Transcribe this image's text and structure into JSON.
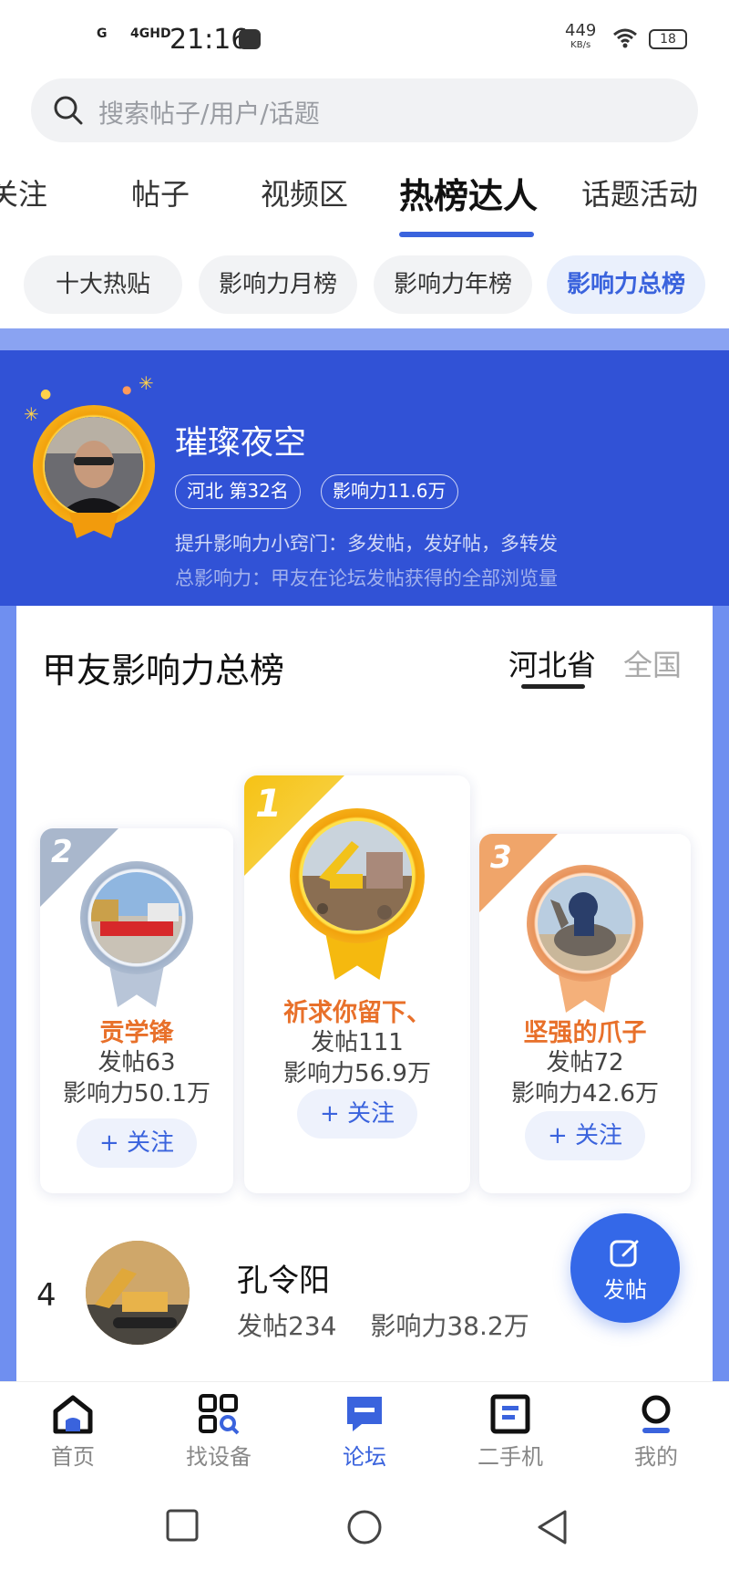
{
  "status_bar": {
    "signal1": "G",
    "signal2": "4GHD",
    "time": "21:16",
    "speed": "449",
    "speed_unit": "KB/s",
    "battery": "18"
  },
  "search": {
    "placeholder": "搜索帖子/用户/话题"
  },
  "tabs": [
    {
      "label": "关注"
    },
    {
      "label": "帖子"
    },
    {
      "label": "视频区"
    },
    {
      "label": "热榜达人"
    },
    {
      "label": "话题活动"
    }
  ],
  "sub_tabs": [
    {
      "label": "十大热贴"
    },
    {
      "label": "影响力月榜"
    },
    {
      "label": "影响力年榜"
    },
    {
      "label": "影响力总榜"
    }
  ],
  "hero": {
    "name": "璀璨夜空",
    "tag_rank": "河北  第32名",
    "tag_influence": "影响力11.6万",
    "tip1": "提升影响力小窍门：多发帖，发好帖，多转发",
    "tip2": "总影响力：甲友在论坛发帖获得的全部浏览量"
  },
  "board": {
    "title": "甲友影响力总榜",
    "region_province": "河北省",
    "region_national": "全国",
    "follow_label": "+ 关注",
    "top3": [
      {
        "rank": "1",
        "name": "祈求你留下、",
        "posts": "发帖111",
        "influence": "影响力56.9万"
      },
      {
        "rank": "2",
        "name": "贡学锋",
        "posts": "发帖63",
        "influence": "影响力50.1万"
      },
      {
        "rank": "3",
        "name": "坚强的爪子",
        "posts": "发帖72",
        "influence": "影响力42.6万"
      }
    ],
    "row4": {
      "rank": "4",
      "name": "孔令阳",
      "posts": "发帖234",
      "influence": "影响力38.2万"
    }
  },
  "fab": {
    "label": "发帖"
  },
  "bottom_nav": [
    {
      "label": "首页",
      "icon": "home-icon"
    },
    {
      "label": "找设备",
      "icon": "find-device-icon"
    },
    {
      "label": "论坛",
      "icon": "forum-icon"
    },
    {
      "label": "二手机",
      "icon": "used-machine-icon"
    },
    {
      "label": "我的",
      "icon": "profile-icon"
    }
  ],
  "colors": {
    "accent": "#3a63dd",
    "hero_bg": "#3152d6",
    "gold": "#f5b90f",
    "silver": "#a9b7cc",
    "bronze": "#f0a56a",
    "name_orange": "#e8702a"
  }
}
